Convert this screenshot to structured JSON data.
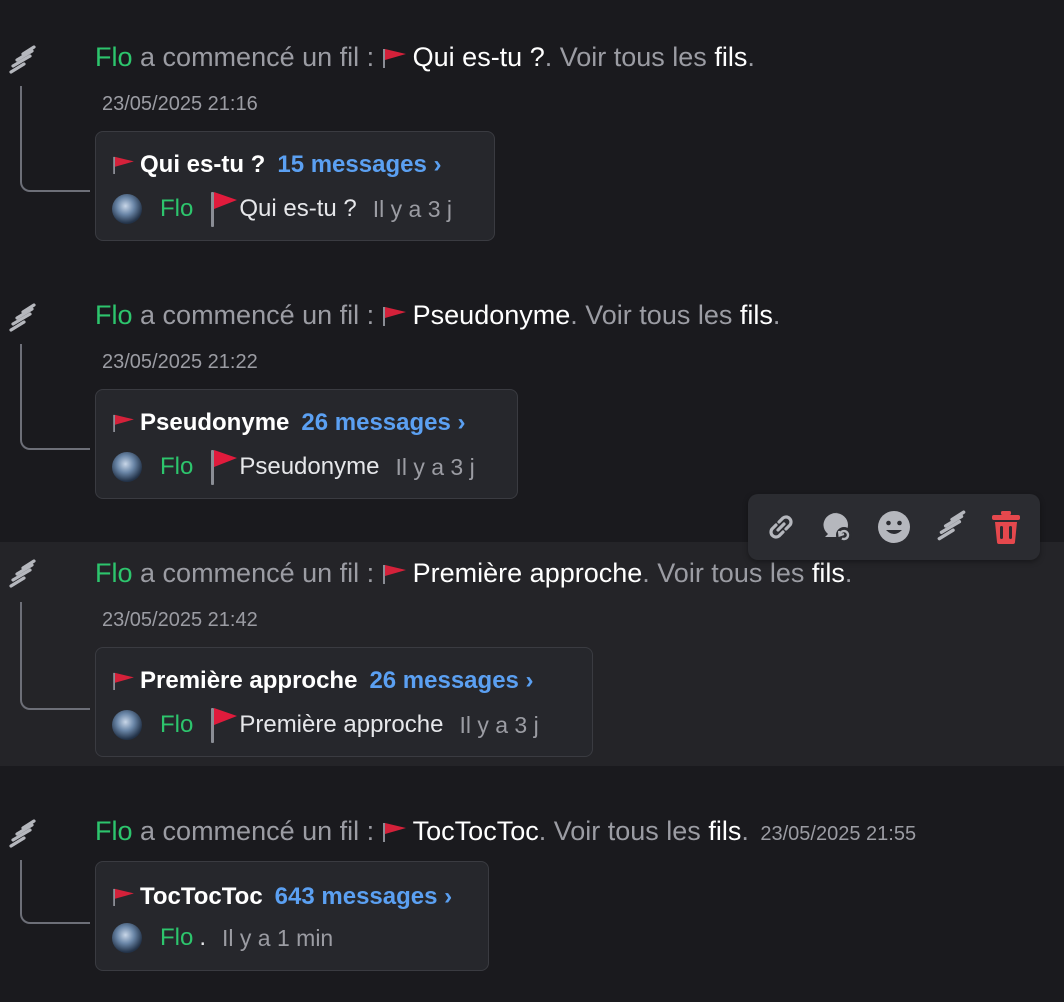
{
  "common": {
    "started_text": "a commencé un fil :",
    "see_all_prefix": ". Voir tous les",
    "threads_word": "fils",
    "period": "."
  },
  "messages": [
    {
      "author": "Flo",
      "thread_name": "Qui es-tu ?",
      "timestamp": "23/05/2025 21:16",
      "card": {
        "title": "Qui es-tu ?",
        "count_label": "15 messages ›",
        "author": "Flo",
        "last_message": "Qui es-tu ?",
        "ago": "Il y a 3 j"
      }
    },
    {
      "author": "Flo",
      "thread_name": "Pseudonyme",
      "timestamp": "23/05/2025 21:22",
      "card": {
        "title": "Pseudonyme",
        "count_label": "26 messages ›",
        "author": "Flo",
        "last_message": "Pseudonyme",
        "ago": "Il y a 3 j"
      }
    },
    {
      "author": "Flo",
      "thread_name": "Première approche",
      "timestamp": "23/05/2025 21:42",
      "card": {
        "title": "Première approche",
        "count_label": "26 messages ›",
        "author": "Flo",
        "last_message": "Première approche",
        "ago": "Il y a 3 j"
      }
    },
    {
      "author": "Flo",
      "thread_name": "TocTocToc",
      "timestamp": "23/05/2025 21:55",
      "card": {
        "title": "TocTocToc",
        "count_label": "643 messages ›",
        "author": "Flo",
        "last_message": ".",
        "ago": "Il y a 1 min"
      }
    }
  ],
  "toolbar": {
    "icons": [
      "link-icon",
      "reply-thread-icon",
      "emoji-reaction-icon",
      "thread-icon",
      "trash-icon"
    ]
  },
  "colors": {
    "background": "#1a1a1e",
    "hover_background": "#242428",
    "author_green": "#2dc56d",
    "link_blue": "#5ba0f2",
    "muted_text": "#9b9ca3",
    "delete_red": "#e5484d",
    "flag_red": "#d4213a"
  }
}
